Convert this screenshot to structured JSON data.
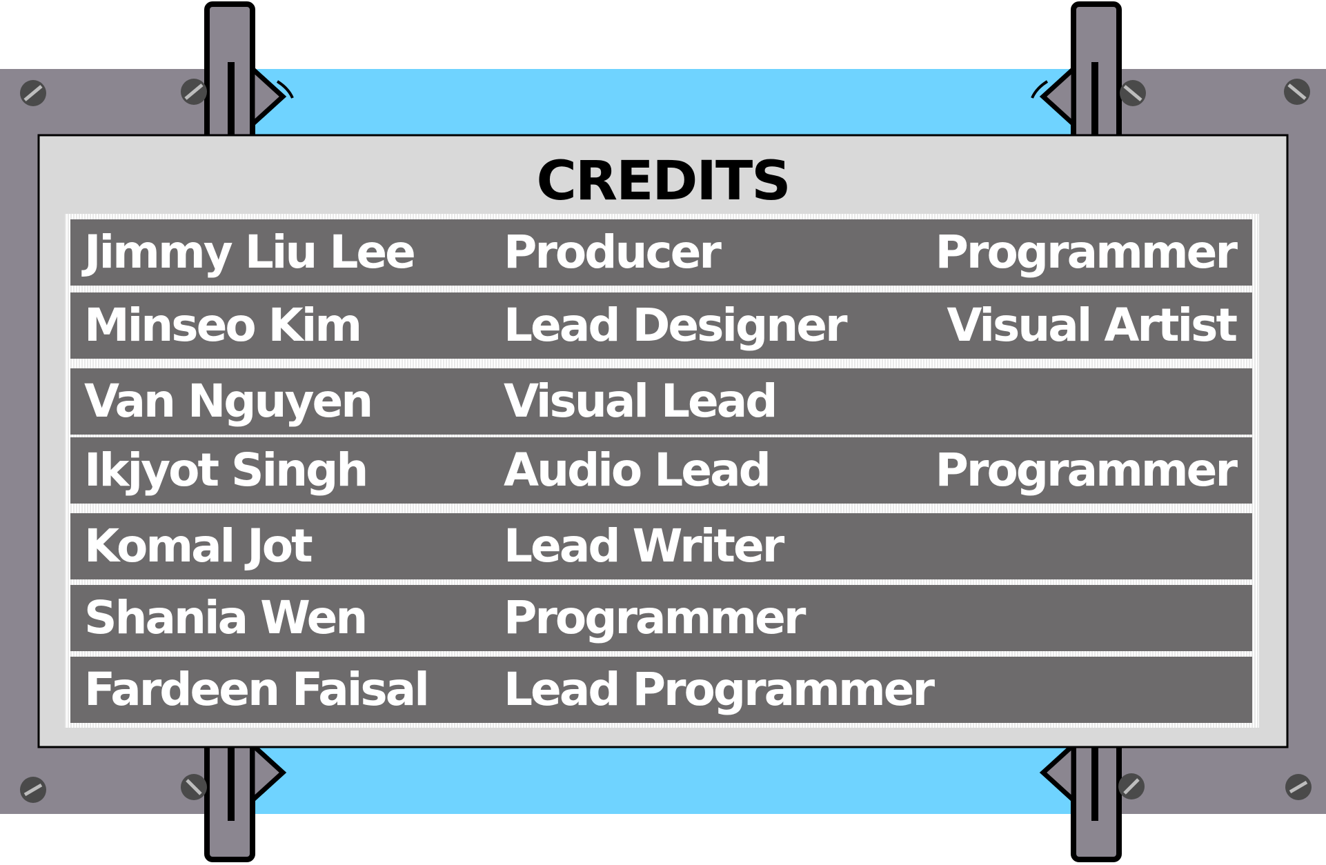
{
  "colors": {
    "sky": "#6fd3ff",
    "metal": "#8b8690",
    "metal_dark": "#6d6870",
    "panel": "#d9d9d9",
    "row": "#6d6b6c",
    "text": "#ffffff",
    "outline": "#000000",
    "screw": "#4a4a4a"
  },
  "credits": {
    "title": "CREDITS",
    "rows": [
      {
        "name": "Jimmy Liu Lee",
        "role1": "Producer",
        "role2": "Programmer"
      },
      {
        "name": "Minseo Kim",
        "role1": "Lead Designer",
        "role2": "Visual Artist"
      },
      {
        "name": "Van Nguyen",
        "role1": "Visual Lead",
        "role2": ""
      },
      {
        "name": "Ikjyot Singh",
        "role1": "Audio Lead",
        "role2": "Programmer"
      },
      {
        "name": "Komal Jot",
        "role1": "Lead Writer",
        "role2": ""
      },
      {
        "name": "Shania Wen",
        "role1": "Programmer",
        "role2": ""
      },
      {
        "name": "Fardeen Faisal",
        "role1": "Lead Programmer",
        "role2": ""
      }
    ]
  },
  "decor": {
    "screw_icon": "screw-icon",
    "clamp_icon": "clamp-icon"
  }
}
